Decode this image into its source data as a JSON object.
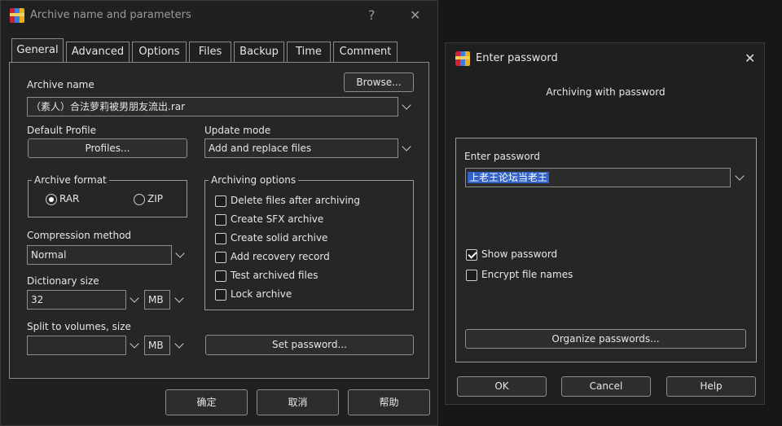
{
  "archive_window": {
    "title": "Archive name and parameters",
    "help_glyph": "?",
    "close_glyph": "✕",
    "tabs": [
      "General",
      "Advanced",
      "Options",
      "Files",
      "Backup",
      "Time",
      "Comment"
    ],
    "archive_name_label": "Archive name",
    "browse_button": "Browse...",
    "archive_name_value": "（素人）合法萝莉被男朋友流出.rar",
    "default_profile_label": "Default Profile",
    "profiles_button": "Profiles...",
    "update_mode_label": "Update mode",
    "update_mode_value": "Add and replace files",
    "archive_format": {
      "title": "Archive format",
      "options": [
        "RAR",
        "ZIP"
      ],
      "selected": "RAR"
    },
    "archiving_options": {
      "title": "Archiving options",
      "items": [
        "Delete files after archiving",
        "Create SFX archive",
        "Create solid archive",
        "Add recovery record",
        "Test archived files",
        "Lock archive"
      ]
    },
    "compression_method_label": "Compression method",
    "compression_method_value": "Normal",
    "dictionary_size_label": "Dictionary size",
    "dictionary_size_value": "32",
    "dictionary_unit": "MB",
    "split_label": "Split to volumes, size",
    "split_value": "",
    "split_unit": "MB",
    "set_password_button": "Set password...",
    "ok_button": "确定",
    "cancel_button": "取消",
    "help_button": "帮助"
  },
  "password_window": {
    "title": "Enter password",
    "close_glyph": "✕",
    "subtitle": "Archiving with password",
    "enter_password_label": "Enter password",
    "password_value": "上老王论坛当老王",
    "show_password_label": "Show password",
    "show_password_checked": true,
    "encrypt_names_label": "Encrypt file names",
    "encrypt_names_checked": false,
    "organize_button": "Organize passwords...",
    "ok_button": "OK",
    "cancel_button": "Cancel",
    "help_button": "Help"
  },
  "colors": {
    "selection": "#3261c8",
    "background": "#171717",
    "window": "#202020"
  }
}
